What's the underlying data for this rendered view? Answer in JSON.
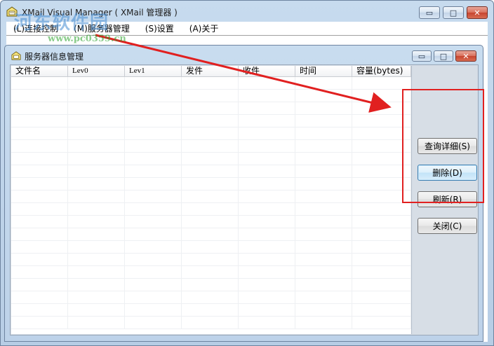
{
  "window": {
    "title": "XMail Visual Manager ( XMail 管理器 )",
    "controls": {
      "minimize": "▭",
      "maximize": "□",
      "close": "✕"
    }
  },
  "menu": {
    "items": [
      {
        "label": "(L)连接控制"
      },
      {
        "label": "(M)服务器管理"
      },
      {
        "label": "(S)设置"
      },
      {
        "label": "(A)关于"
      }
    ]
  },
  "child": {
    "title": "服务器信息管理",
    "controls": {
      "minimize": "▭",
      "maximize": "□",
      "close": "✕"
    },
    "columns": [
      {
        "label": "文件名"
      },
      {
        "label": "Lev0"
      },
      {
        "label": "Lev1"
      },
      {
        "label": "发件"
      },
      {
        "label": "收件"
      },
      {
        "label": "时间"
      },
      {
        "label": "容量(bytes)"
      }
    ],
    "buttons": [
      {
        "label": "查询详细(S)"
      },
      {
        "label": "删除(D)"
      },
      {
        "label": "刷新(R)"
      },
      {
        "label": "关闭(C)"
      }
    ]
  },
  "watermark": {
    "text": "河东软件园",
    "url": "www.pc0359.cn"
  },
  "colors": {
    "annotation": "#e12020",
    "watermark": "#468cd2"
  }
}
